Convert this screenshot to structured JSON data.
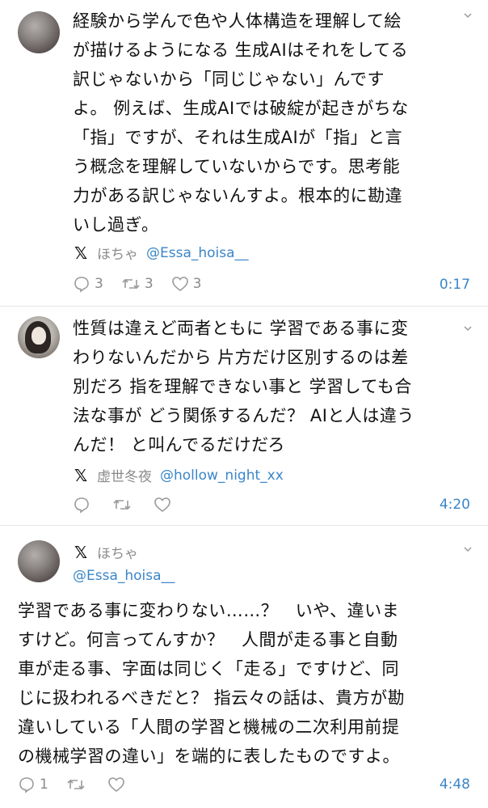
{
  "posts": [
    {
      "text": "経験から学んで色や人体構造を理解して絵\nが描けるようになる 生成AIはそれをしてる\n訳じゃないから「同じじゃない」んです\nよ。 例えば、生成AIでは破綻が起きがちな\n「指」ですが、それは生成AIが「指」と言\nう概念を理解していないからです。思考能\n力がある訳じゃないんすよ。根本的に勘違\nいし過ぎ。",
      "author_name": "ほちゃ",
      "author_handle": "@Essa_hoisa__",
      "replies": "3",
      "reposts": "3",
      "likes": "3",
      "time": "0:17"
    },
    {
      "text": "性質は違えど両者ともに 学習である事に変\nわりないんだから 片方だけ区別するのは差\n別だろ 指を理解できない事と 学習しても合\n法な事が どう関係するんだ？ AIと人は違う\nんだ！ と叫んでるだけだろ",
      "author_name": "虚世冬夜",
      "author_handle": "@hollow_night_xx",
      "replies": "",
      "reposts": "",
      "likes": "",
      "time": "4:20"
    },
    {
      "text": "学習である事に変わりない……？　いや、違いま\nすけど。何言ってんすか？　人間が走る事と自動\n車が走る事、字面は同じく「走る」ですけど、同\nじに扱われるべきだと？ 指云々の話は、貴方が勘\n違いしている「人間の学習と機械の二次利用前提\nの機械学習の違い」を端的に表したものですよ。",
      "author_name": "ほちゃ",
      "author_handle": "@Essa_hoisa__",
      "replies": "1",
      "reposts": "",
      "likes": "",
      "time": "4:48"
    }
  ],
  "icons": {
    "platform": "x-logo",
    "reply": "reply-icon",
    "repost": "repost-icon",
    "like": "heart-icon",
    "more": "chevron-down-icon"
  },
  "colors": {
    "handle": "#3a86c8",
    "time": "#3a86c8",
    "meta": "#8a8a8a"
  }
}
